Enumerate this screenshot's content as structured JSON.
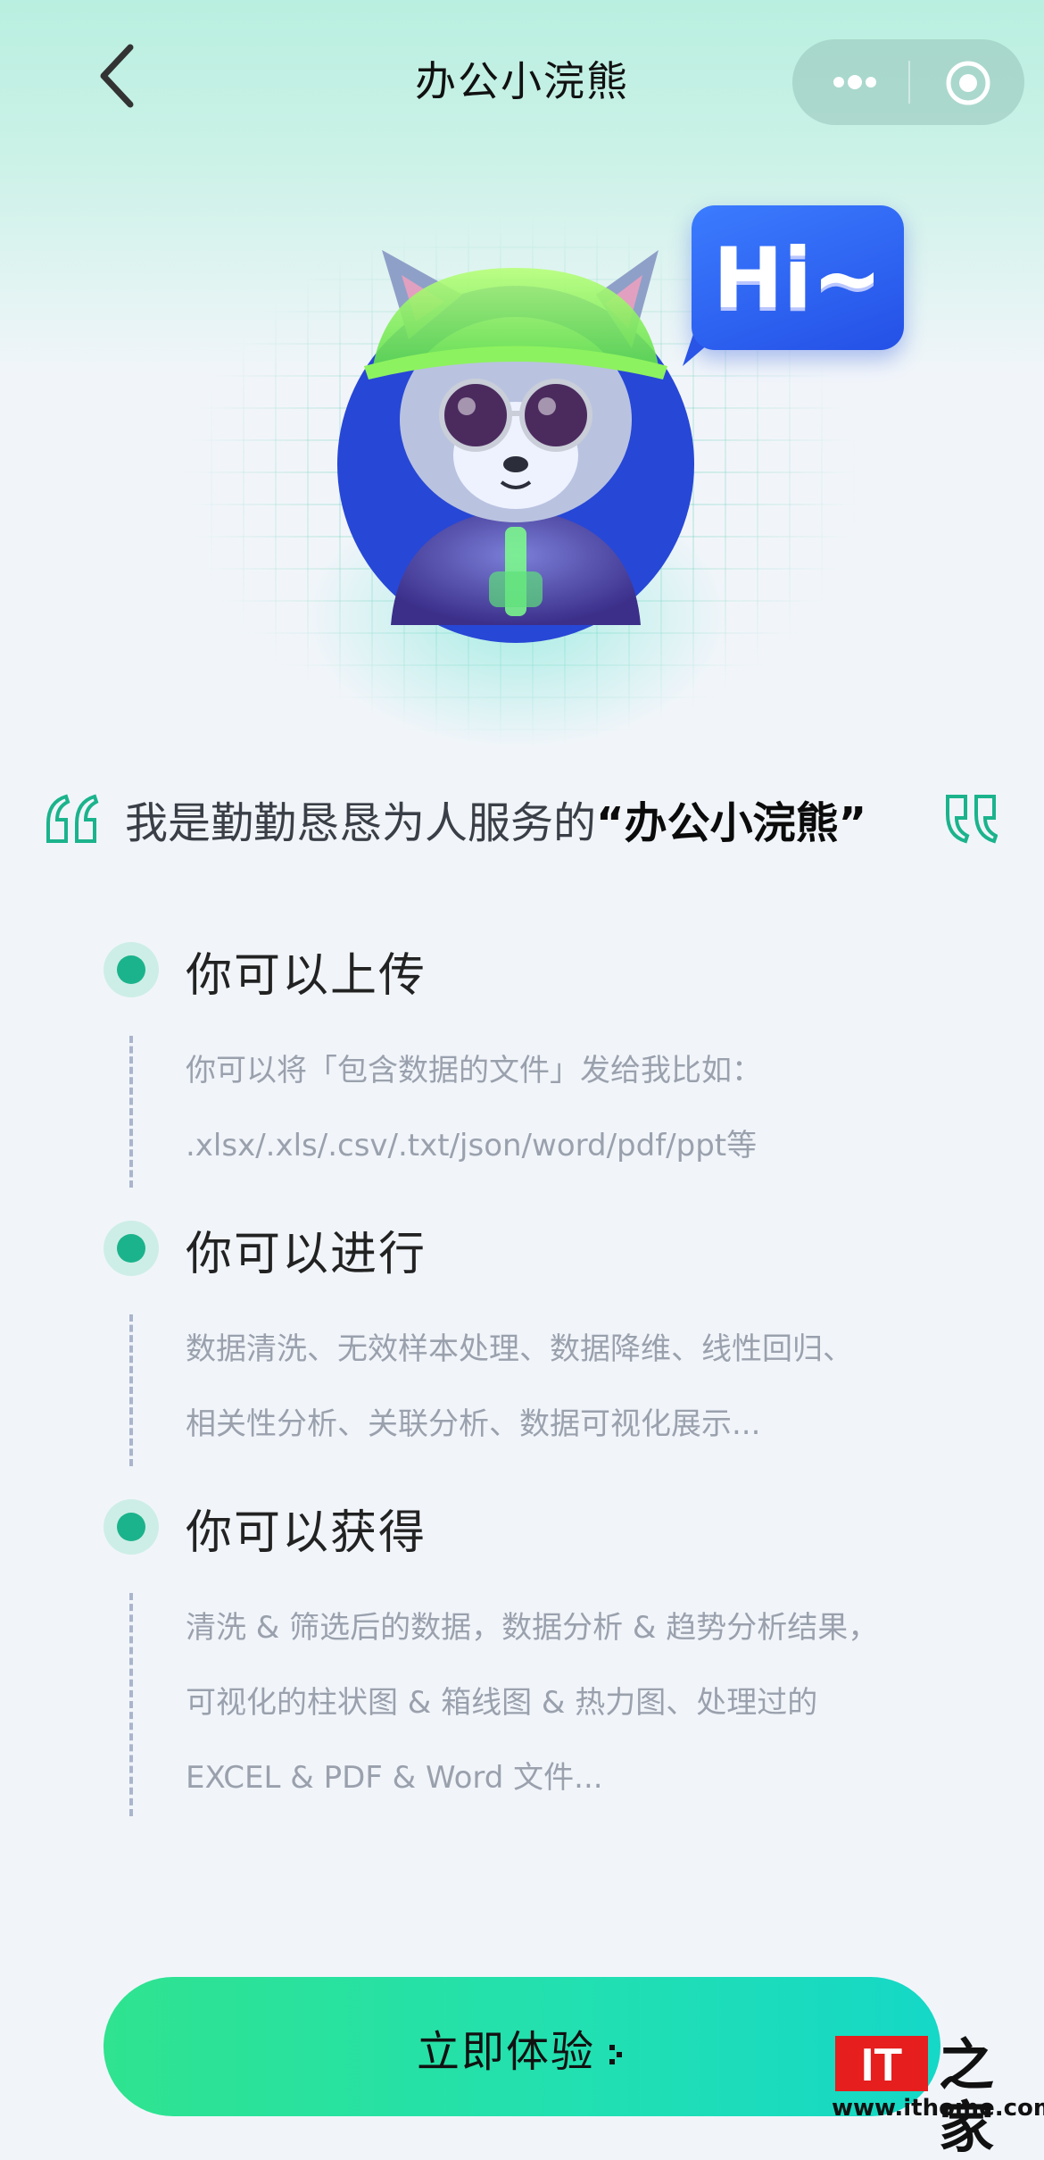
{
  "nav": {
    "title": "办公小浣熊"
  },
  "hero": {
    "bubble_text": "Hi~"
  },
  "intro": {
    "prefix": "我是勤勤恳恳为人服务的",
    "name": "“办公小浣熊”"
  },
  "sections": [
    {
      "title": "你可以上传",
      "lines": [
        "你可以将「包含数据的文件」发给我比如：",
        ".xlsx/.xls/.csv/.txt/json/word/pdf/ppt等"
      ]
    },
    {
      "title": "你可以进行",
      "lines": [
        "数据清洗、无效样本处理、数据降维、线性回归、",
        "相关性分析、关联分析、数据可视化展示..."
      ]
    },
    {
      "title": "你可以获得",
      "lines": [
        "清洗 & 筛选后的数据，数据分析 & 趋势分析结果，",
        "可视化的柱状图 & 箱线图 & 热力图、处理过的",
        "EXCEL & PDF & Word 文件..."
      ]
    }
  ],
  "cta": {
    "label": "立即体验"
  },
  "watermark": {
    "logo": "IT",
    "glyph": "之家",
    "url": "www.ithome.com"
  },
  "colors": {
    "accent": "#1bb38c",
    "cta_start": "#2fe38f",
    "cta_end": "#15d8c7",
    "bubble": "#2f66f0"
  },
  "icons": [
    "back-arrow-icon",
    "more-dots-icon",
    "target-icon",
    "quote-open-icon",
    "quote-close-icon",
    "arrow-right-icon"
  ]
}
